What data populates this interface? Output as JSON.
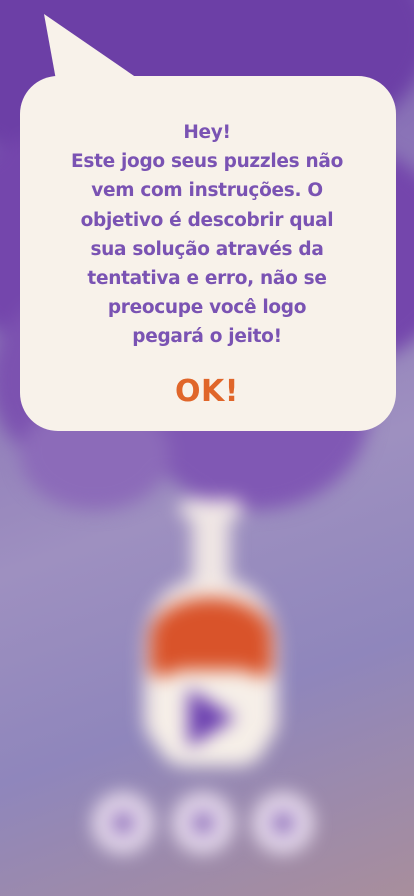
{
  "dialog": {
    "greeting": "Hey!",
    "message_lines": [
      "Este jogo seus puzzles não",
      "vem com instruções. O",
      "objetivo é descobrir qual",
      "sua solução através da",
      "tentativa e erro, não se",
      "preocupe você logo",
      "pegará o jeito!"
    ],
    "ok_label": "OK!"
  },
  "background": {
    "play_icon": "play-icon",
    "bottom_buttons": [
      "round-button",
      "round-button",
      "round-button"
    ]
  },
  "colors": {
    "dialog_text": "#7a53b3",
    "ok_text": "#e0662a",
    "bubble_bg": "#f8f2ea",
    "smoke": "#6c3fa6",
    "potion_liquid": "#d9532a"
  }
}
